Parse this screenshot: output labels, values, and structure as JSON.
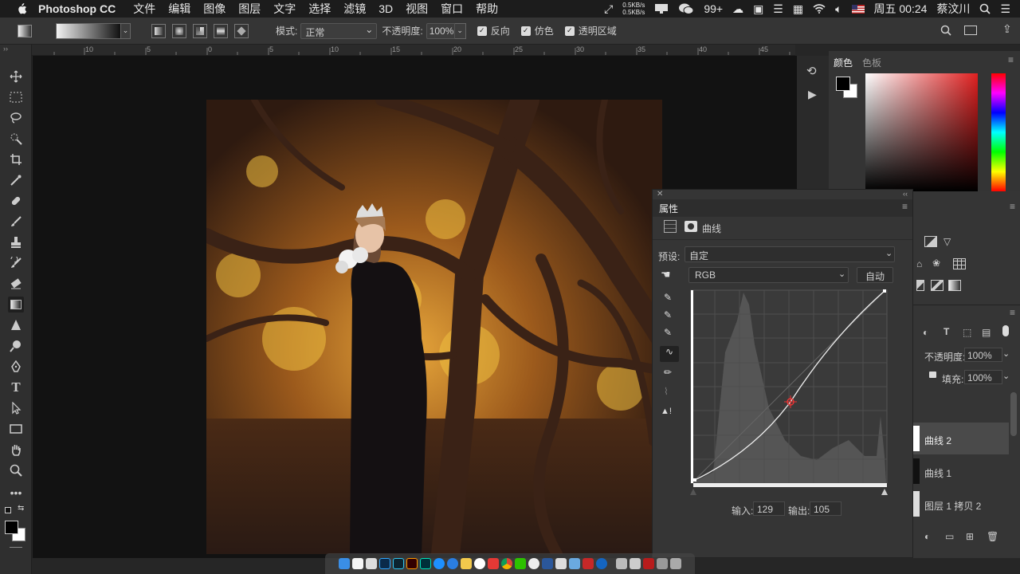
{
  "menubar": {
    "app": "Photoshop CC",
    "menus": [
      "文件",
      "编辑",
      "图像",
      "图层",
      "文字",
      "选择",
      "滤镜",
      "3D",
      "视图",
      "窗口",
      "帮助"
    ],
    "net_up": "0.5KB/s",
    "net_down": "0.5KB/s",
    "badge": "99+",
    "datetime": "周五 00:24",
    "user": "蔡汶川"
  },
  "options": {
    "mode_label": "模式:",
    "mode_value": "正常",
    "opacity_label": "不透明度:",
    "opacity_value": "100%",
    "reverse": "反向",
    "dither": "仿色",
    "transparency": "透明区域"
  },
  "ruler": {
    "ticks": [
      "10",
      "5",
      "0",
      "5",
      "10",
      "15",
      "20",
      "25",
      "30",
      "35",
      "40",
      "45"
    ]
  },
  "color_panel": {
    "tab_color": "颜色",
    "tab_swatches": "色板"
  },
  "properties": {
    "title": "属性",
    "adjust_name": "曲线",
    "preset_label": "预设:",
    "preset_value": "自定",
    "channel_value": "RGB",
    "auto_label": "自动",
    "input_label": "输入:",
    "input_value": "129",
    "output_label": "输出:",
    "output_value": "105"
  },
  "layers": {
    "opacity_label": "不透明度:",
    "opacity_value": "100%",
    "fill_label": "填充:",
    "fill_value": "100%",
    "items": [
      "曲线 2",
      "曲线 1",
      "图层 1 拷贝 2"
    ]
  }
}
